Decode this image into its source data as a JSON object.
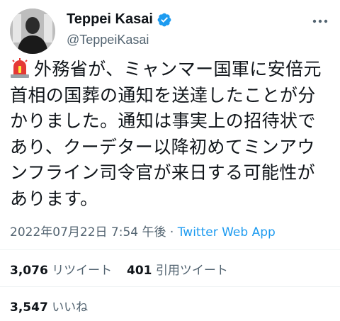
{
  "author": {
    "display_name": "Teppei Kasai",
    "handle": "@TeppeiKasai",
    "verified": true,
    "avatar_icon": "profile-photo",
    "more_icon": "more-options-icon"
  },
  "tweet": {
    "emoji_icon": "rotating-light-icon",
    "text": "外務省が、ミャンマー国軍に安倍元首相の国葬の通知を送達したことが分かりました。通知は事実上の招待状であり、クーデター以降初めてミンアウンフライン司令官が来日する可能性があります。",
    "date": "2022年07月22日 7:54 午後",
    "separator": "·",
    "source": "Twitter Web App"
  },
  "stats": {
    "retweets": "3,076",
    "retweets_label": "リツイート",
    "quotes": "401",
    "quotes_label": "引用ツイート",
    "likes": "3,547",
    "likes_label": "いいね"
  },
  "colors": {
    "accent": "#1d9bf0",
    "secondary_text": "#536471",
    "primary_text": "#0f1419",
    "divider": "#eff3f4"
  }
}
